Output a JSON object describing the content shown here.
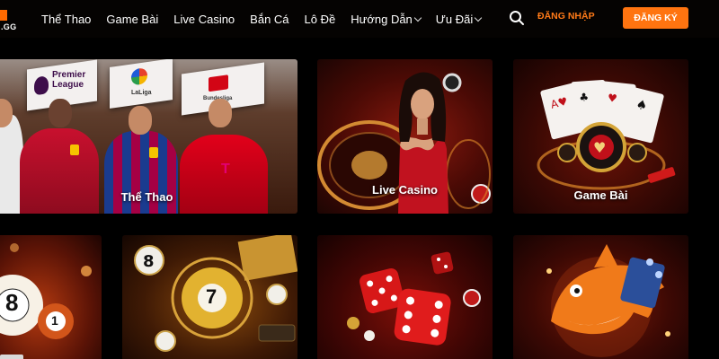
{
  "header": {
    "logo_text": ".GG",
    "nav": [
      {
        "label": "Thể Thao"
      },
      {
        "label": "Game Bài"
      },
      {
        "label": "Live Casino"
      },
      {
        "label": "Bắn Cá"
      },
      {
        "label": "Lô Đề"
      },
      {
        "label": "Hướng Dẫn"
      },
      {
        "label": "Ưu Đãi"
      }
    ],
    "login_label": "ĐĂNG NHẬP",
    "register_label": "ĐĂNG KÝ"
  },
  "tiles": {
    "sport": {
      "label": "Thể Thao",
      "flags": [
        "Premier League",
        "LaLiga",
        "Bundesliga"
      ]
    },
    "casino": {
      "label": "Live Casino"
    },
    "cards": {
      "label": "Game Bài"
    },
    "lottery": {
      "balls": [
        "8",
        "1",
        "7"
      ]
    }
  },
  "colors": {
    "accent": "#ff7410",
    "background": "#000000"
  }
}
